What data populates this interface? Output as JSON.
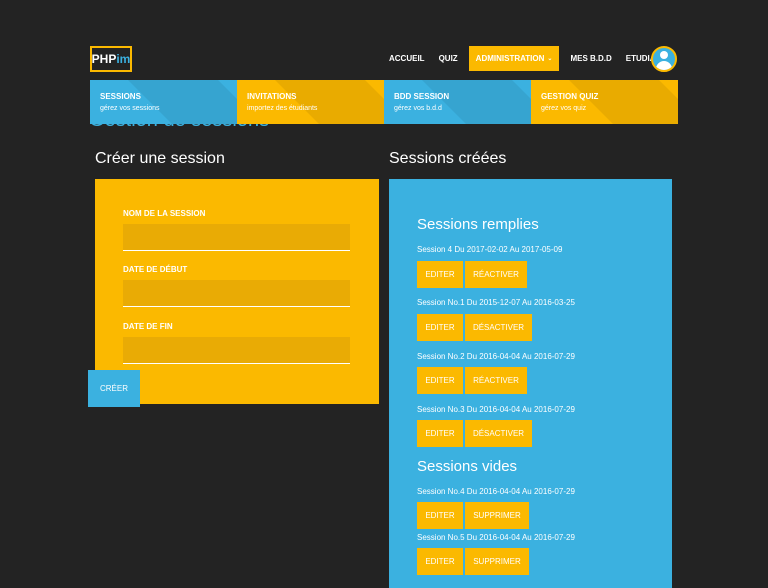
{
  "logo": {
    "text_main": "PHP",
    "text_accent": "im"
  },
  "nav": {
    "items": [
      {
        "label": "ACCUEIL"
      },
      {
        "label": "QUIZ"
      },
      {
        "label": "ADMINISTRATION",
        "caret": "⌄"
      },
      {
        "label": "MES B.D.D"
      },
      {
        "label": "ETUDIANTS"
      }
    ]
  },
  "tiles": [
    {
      "title": "SESSIONS",
      "subtitle": "gérez vos sessions"
    },
    {
      "title": "INVITATIONS",
      "subtitle": "importez des étudiants"
    },
    {
      "title": "BDD SESSION",
      "subtitle": "gérez vos b.d.d"
    },
    {
      "title": "GESTION QUIZ",
      "subtitle": "gérez vos quiz"
    }
  ],
  "page": {
    "title": "Gestion de sessions"
  },
  "create": {
    "heading": "Créer une session",
    "fields": [
      {
        "label": "NOM DE LA SESSION",
        "value": ""
      },
      {
        "label": "DATE DE DÉBUT",
        "value": ""
      },
      {
        "label": "DATE DE FIN",
        "value": ""
      }
    ],
    "button": "CRÉER"
  },
  "sessions": {
    "heading": "Sessions créées",
    "filled_heading": "Sessions remplies",
    "filled": [
      {
        "text": "Session 4 Du 2017-02-02 Au 2017-05-09",
        "edit": "EDITER",
        "action": "RÉACTIVER"
      },
      {
        "text": "Session No.1 Du 2015-12-07 Au 2016-03-25",
        "edit": "EDITER",
        "action": "DÉSACTIVER"
      },
      {
        "text": "Session No.2 Du 2016-04-04 Au 2016-07-29",
        "edit": "EDITER",
        "action": "RÉACTIVER"
      },
      {
        "text": "Session No.3 Du 2016-04-04 Au 2016-07-29",
        "edit": "EDITER",
        "action": "DÉSACTIVER"
      }
    ],
    "empty_heading": "Sessions vides",
    "empty": [
      {
        "text": "Session No.4 Du 2016-04-04 Au 2016-07-29",
        "edit": "EDITER",
        "action": "SUPPRIMER"
      },
      {
        "text": "Session No.5 Du 2016-04-04 Au 2016-07-29",
        "edit": "EDITER",
        "action": "SUPPRIMER"
      }
    ]
  },
  "colors": {
    "background": "#232323",
    "yellow": "#fbb900",
    "blue": "#3bb1e0",
    "text": "#ffffff"
  }
}
